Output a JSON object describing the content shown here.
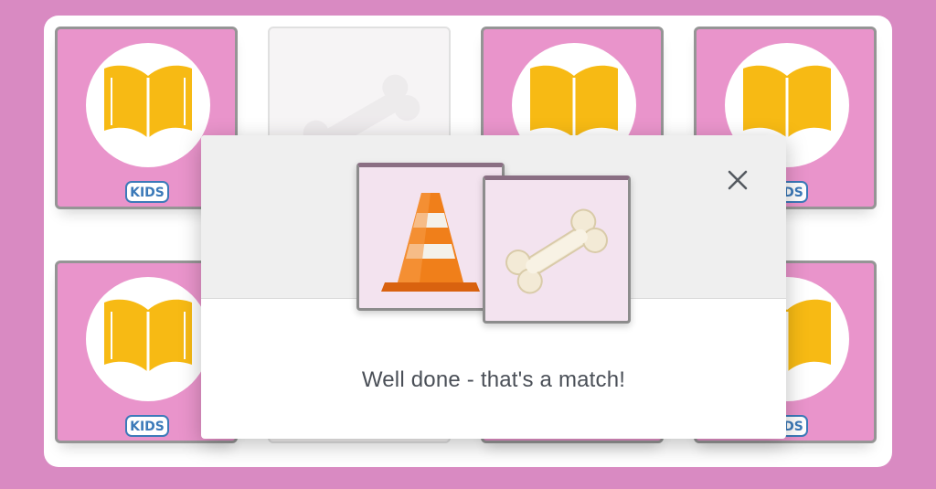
{
  "game": {
    "card_back_badge": "KIDS",
    "match_message": "Well done - that's a match!",
    "matched_cards": [
      "traffic-cone",
      "bone"
    ]
  },
  "colors": {
    "page_background": "#d98ac2",
    "card_back": "#e88bc7",
    "book": "#f7b500",
    "cone": "#f07f1a",
    "modal_header": "#efefef"
  },
  "icons": {
    "card_back": "open-book-icon",
    "matched_a": "traffic-cone-icon",
    "matched_b": "bone-icon",
    "close": "close-icon"
  }
}
